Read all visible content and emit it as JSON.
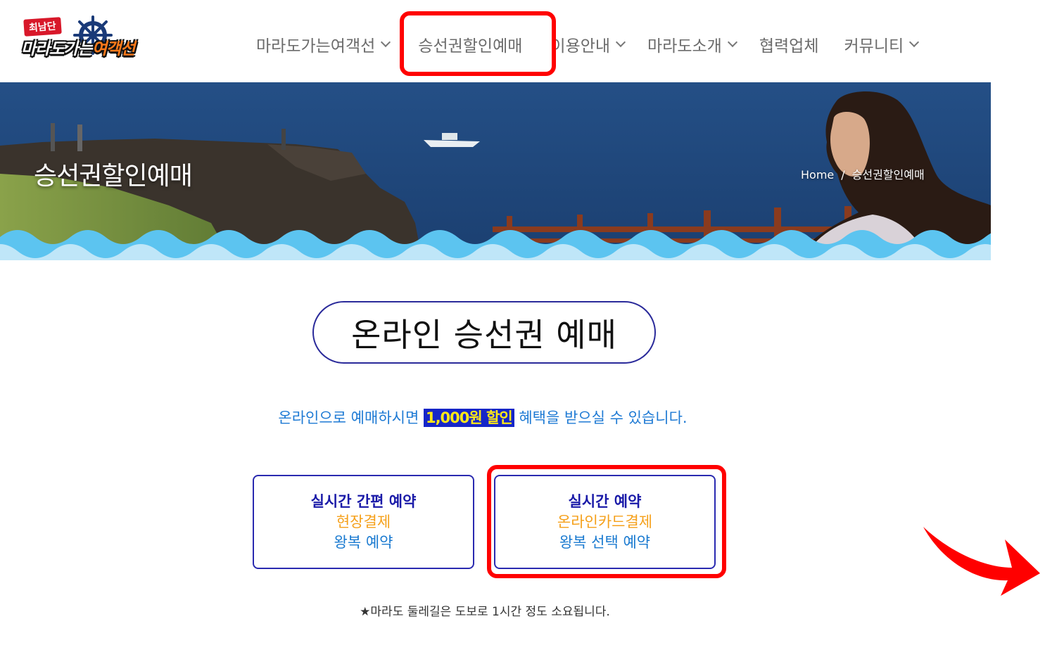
{
  "logo": {
    "badge": "최남단",
    "text_main": "마라도가는",
    "text_highlight": "여객선"
  },
  "nav": {
    "items": [
      {
        "label": "마라도가는여객선",
        "dropdown": true
      },
      {
        "label": "승선권할인예매",
        "dropdown": false
      },
      {
        "label": "이용안내",
        "dropdown": true
      },
      {
        "label": "마라도소개",
        "dropdown": true
      },
      {
        "label": "협력업체",
        "dropdown": false
      },
      {
        "label": "커뮤니티",
        "dropdown": true
      }
    ]
  },
  "banner": {
    "title": "승선권할인예매",
    "breadcrumb": {
      "home": "Home",
      "separator": "/",
      "current": "승선권할인예매"
    }
  },
  "main": {
    "heading": "온라인 승선권 예매",
    "discount_prefix": "온라인으로 예매하시면 ",
    "discount_highlight": "1,000원 할인",
    "discount_suffix": " 혜택을 받으실 수 있습니다.",
    "options": [
      {
        "line1": "실시간 간편 예약",
        "line2": "현장결제",
        "line3": "왕복 예약"
      },
      {
        "line1": "실시간 예약",
        "line2": "온라인카드결제",
        "line3": "왕복 선택 예약"
      }
    ],
    "note": "★마라도 둘레길은 도보로 1시간 정도 소요됩니다."
  },
  "colors": {
    "annotation_red": "#ff0000",
    "option_border": "#2a2ab0",
    "highlight_bg": "#1626c8",
    "highlight_text": "#ffe818",
    "sea": "#1e4f8c",
    "wave_light": "#bfe6f8",
    "wave_dark": "#5cc4f0"
  }
}
